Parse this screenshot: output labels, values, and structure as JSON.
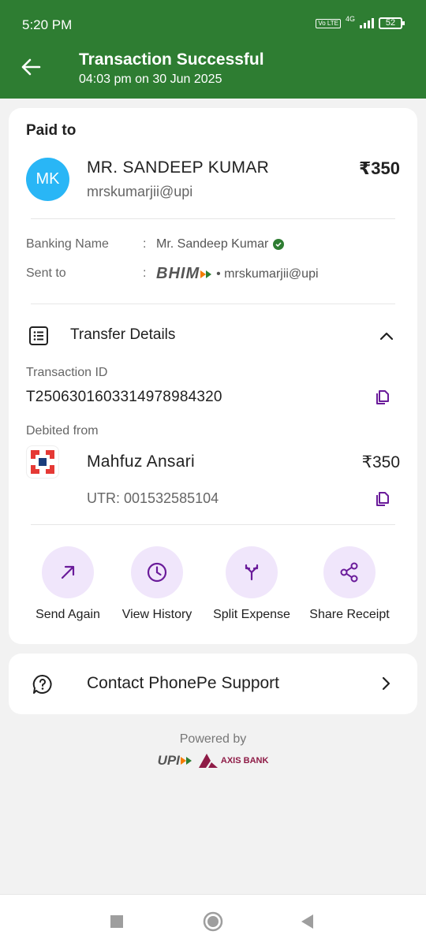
{
  "status_bar": {
    "time": "5:20 PM",
    "volte": "Vo LTE",
    "network": "4G",
    "battery": "52"
  },
  "header": {
    "title": "Transaction Successful",
    "subtitle": "04:03 pm on 30 Jun 2025"
  },
  "paid_to": {
    "heading": "Paid to",
    "initials": "MK",
    "name": "MR. SANDEEP  KUMAR",
    "upi_id": "mrskumarjii@upi",
    "amount": "₹350"
  },
  "details": {
    "banking_name_label": "Banking Name",
    "banking_name_value": "Mr. Sandeep  Kumar",
    "sent_to_label": "Sent to",
    "sent_to_logo": "BHIM",
    "sent_to_value": "• mrskumarjii@upi",
    "colon": ":"
  },
  "transfer": {
    "title": "Transfer Details",
    "txn_label": "Transaction ID",
    "txn_id": "T2506301603314978984320",
    "debited_label": "Debited from",
    "debit_name": "Mahfuz Ansari",
    "debit_amount": "₹350",
    "utr": "UTR: 001532585104"
  },
  "actions": [
    {
      "label": "Send Again",
      "icon": "arrow-up-right-icon"
    },
    {
      "label": "View History",
      "icon": "clock-icon"
    },
    {
      "label": "Split Expense",
      "icon": "split-icon"
    },
    {
      "label": "Share Receipt",
      "icon": "share-icon"
    }
  ],
  "support": {
    "label": "Contact PhonePe Support"
  },
  "footer": {
    "powered_by": "Powered by",
    "upi_logo": "UPI",
    "bank_logo": "AXIS BANK"
  },
  "colors": {
    "header": "#2e7d32",
    "accent": "#6a1b9a",
    "action_bg": "#f0e6fb",
    "avatar": "#29b6f6"
  }
}
